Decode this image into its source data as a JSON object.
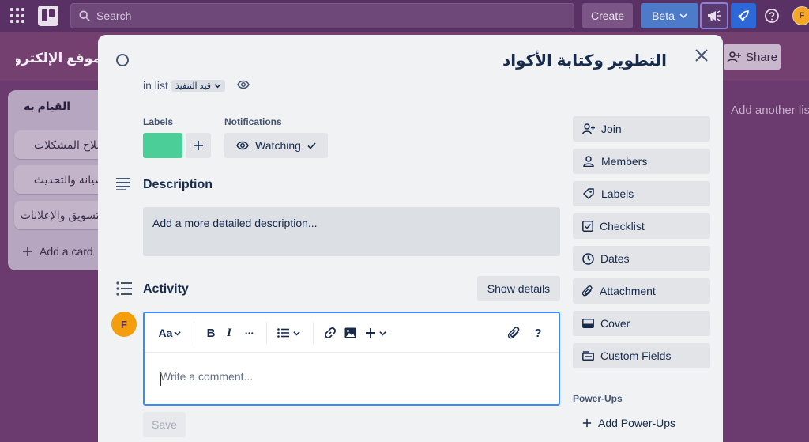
{
  "topbar": {
    "search_placeholder": "Search",
    "create_label": "Create",
    "beta_label": "Beta",
    "avatar_initial": "F"
  },
  "board": {
    "title": "موقع الإلكتروني",
    "share_label": "Share",
    "add_list_label": "Add another list",
    "list": {
      "title": "القيام به",
      "cards": [
        "إصلاح المشكلات",
        "الصيانة والتحديث",
        "التسويق والإعلانات"
      ],
      "add_card_label": "Add a card"
    }
  },
  "card": {
    "title": "التطوير وكتابة الأكواد",
    "in_list_prefix": "in list",
    "list_name": "قيد التنفيذ",
    "labels_heading": "Labels",
    "label_color": "#4bce97",
    "notifications_heading": "Notifications",
    "watching_label": "Watching",
    "description_heading": "Description",
    "description_placeholder": "Add a more detailed description...",
    "activity_heading": "Activity",
    "show_details_label": "Show details",
    "avatar_initial": "F",
    "comment_placeholder": "Write a comment...",
    "toolbar": {
      "text_style": "Aa",
      "bold": "B",
      "italic": "I",
      "more": "•••",
      "help": "?"
    },
    "save_label": "Save",
    "sidebar": {
      "join": "Join",
      "members": "Members",
      "labels": "Labels",
      "checklist": "Checklist",
      "dates": "Dates",
      "attachment": "Attachment",
      "cover": "Cover",
      "custom_fields": "Custom Fields"
    },
    "powerups_heading": "Power-Ups",
    "add_powerups_label": "Add Power-Ups"
  }
}
